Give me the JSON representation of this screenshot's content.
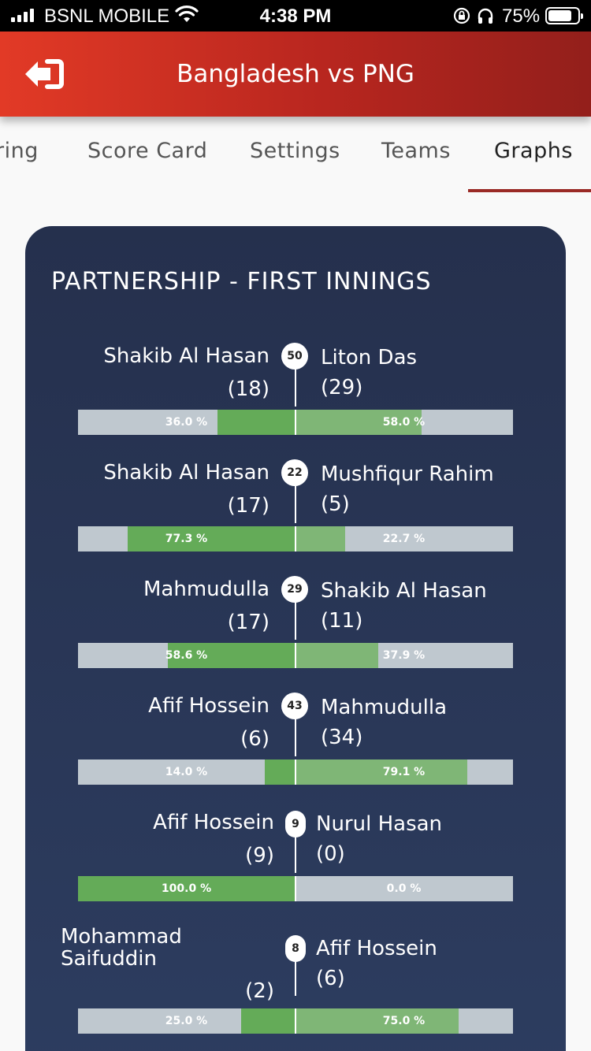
{
  "status_bar": {
    "carrier": "BSNL MOBILE",
    "time": "4:38 PM",
    "battery": "75%",
    "battery_level": 0.75
  },
  "header": {
    "title": "Bangladesh vs PNG",
    "back_icon": "logout-arrow-icon"
  },
  "tabs": [
    {
      "label": "ring",
      "active": false
    },
    {
      "label": "Score Card",
      "active": false
    },
    {
      "label": "Settings",
      "active": false
    },
    {
      "label": "Teams",
      "active": false
    },
    {
      "label": "Graphs",
      "active": true
    }
  ],
  "panel": {
    "title": "PARTNERSHIP - FIRST INNINGS"
  },
  "colors": {
    "header_start": "#e23a26",
    "header_end": "#931f1b",
    "panel_bg": "#25304d",
    "bar_green": "#64ab58",
    "bar_green_light": "#7fb676",
    "bar_gray": "#bfc8cf",
    "tab_underline": "#9a2a26"
  },
  "partnerships": [
    {
      "total": "50",
      "left_name": "Shakib Al Hasan",
      "left_runs": "(18)",
      "right_name": "Liton Das",
      "right_runs": "(29)",
      "left_pct": "36.0 %",
      "right_pct": "58.0 %",
      "left_value": 36.0,
      "right_value": 58.0
    },
    {
      "total": "22",
      "left_name": "Shakib Al Hasan",
      "left_runs": "(17)",
      "right_name": "Mushfiqur Rahim",
      "right_runs": "(5)",
      "left_pct": "77.3 %",
      "right_pct": "22.7 %",
      "left_value": 77.3,
      "right_value": 22.7
    },
    {
      "total": "29",
      "left_name": "Mahmudulla",
      "left_runs": "(17)",
      "right_name": "Shakib Al Hasan",
      "right_runs": "(11)",
      "left_pct": "58.6 %",
      "right_pct": "37.9 %",
      "left_value": 58.6,
      "right_value": 37.9
    },
    {
      "total": "43",
      "left_name": "Afif Hossein",
      "left_runs": "(6)",
      "right_name": "Mahmudulla",
      "right_runs": "(34)",
      "left_pct": "14.0 %",
      "right_pct": "79.1 %",
      "left_value": 14.0,
      "right_value": 79.1
    },
    {
      "total": "9",
      "left_name": "Afif Hossein",
      "left_runs": "(9)",
      "right_name": "Nurul Hasan",
      "right_runs": "(0)",
      "left_pct": "100.0 %",
      "right_pct": "0.0 %",
      "left_value": 100.0,
      "right_value": 0.0
    },
    {
      "total": "8",
      "left_name": "Mohammad Saifuddin",
      "left_runs": "(2)",
      "right_name": "Afif Hossein",
      "right_runs": "(6)",
      "left_pct": "25.0 %",
      "right_pct": "75.0 %",
      "left_value": 25.0,
      "right_value": 75.0
    }
  ]
}
